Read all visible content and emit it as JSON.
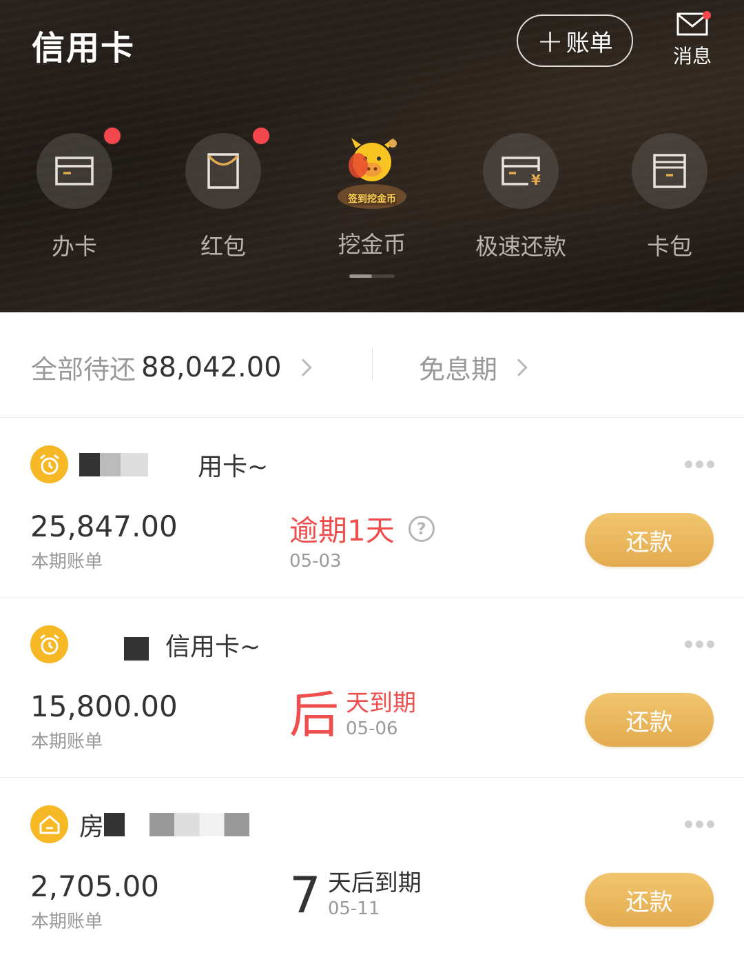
{
  "header": {
    "title": "信用卡",
    "add_bill_label": "账单",
    "message_label": "消息"
  },
  "shortcuts": [
    {
      "label": "办卡",
      "icon": "card-icon",
      "badge": true
    },
    {
      "label": "红包",
      "icon": "red-envelope-icon",
      "badge": true
    },
    {
      "label": "挖金币",
      "icon": "mascot-icon",
      "badge": false,
      "banner_text": "签到挖金币"
    },
    {
      "label": "极速还款",
      "icon": "quick-repay-icon",
      "badge": false
    },
    {
      "label": "卡包",
      "icon": "card-wallet-icon",
      "badge": false
    }
  ],
  "summary": {
    "total_label": "全部待还",
    "total_amount": "88,042.00",
    "grace_label": "免息期"
  },
  "cards": [
    {
      "name_suffix": "用卡~",
      "amount": "25,847.00",
      "amount_label": "本期账单",
      "status": "逾期1天",
      "date": "05-03",
      "action": "还款"
    },
    {
      "name_suffix": "信用卡~",
      "amount": "15,800.00",
      "amount_label": "本期账单",
      "due_num": "后",
      "due_text": "天到期",
      "date": "05-06",
      "action": "还款"
    },
    {
      "name_prefix": "房",
      "amount": "2,705.00",
      "amount_label": "本期账单",
      "due_num": "7",
      "due_text": "天后到期",
      "date": "05-11",
      "action": "还款"
    }
  ],
  "colors": {
    "accent_gold": "#e3ab4f",
    "alert_red": "#ee4e4e",
    "badge_red": "#f4474d",
    "icon_yellow": "#f7b825"
  }
}
